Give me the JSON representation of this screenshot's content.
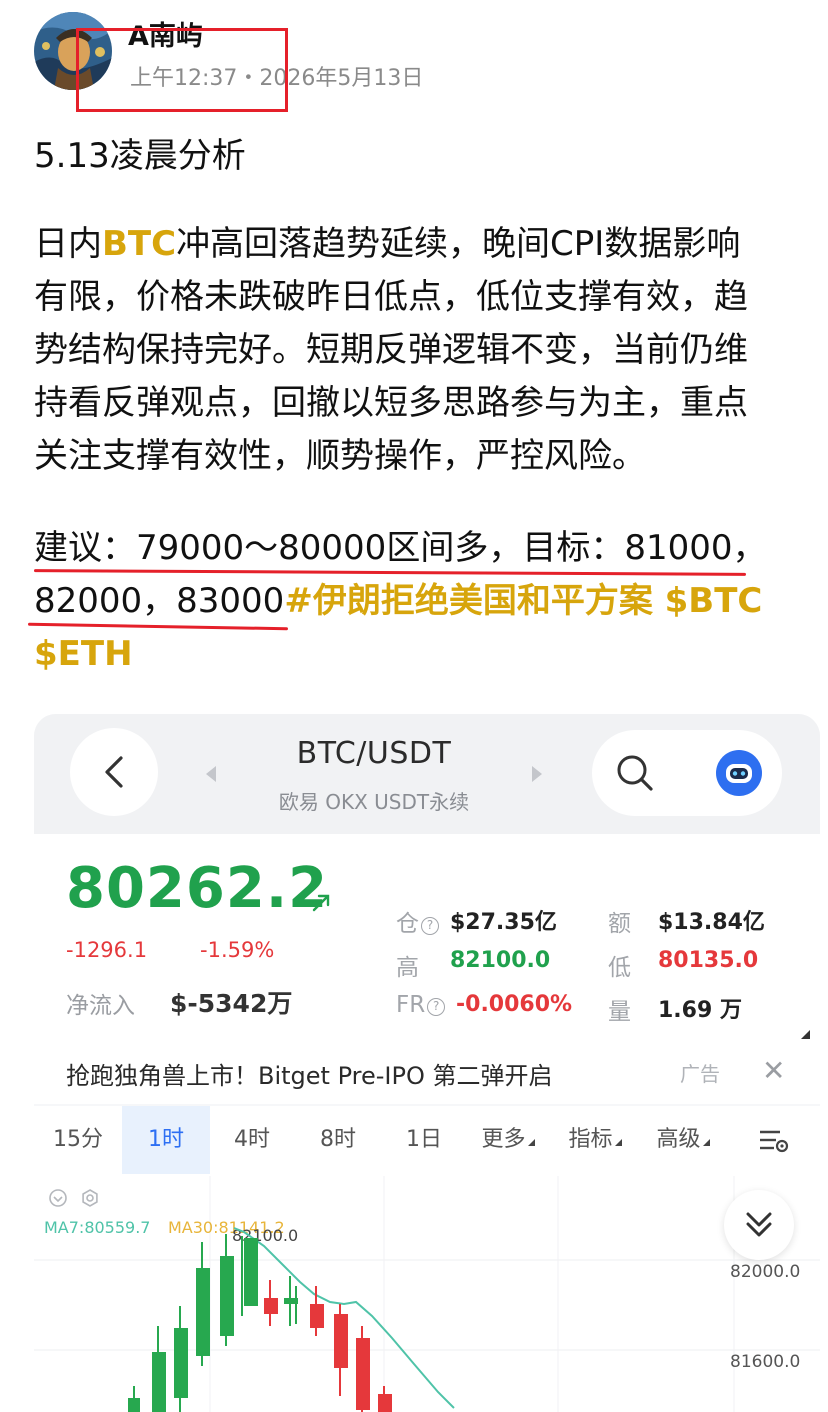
{
  "post": {
    "author": "A南屿",
    "time": "上午12:37・2026年5月13日",
    "subtitle": "5.13凌晨分析",
    "body": {
      "l1_a": "日内",
      "l1_hl": "BTC",
      "l1_b": "冲高回落趋势延续，晚间CPI数据影响",
      "l2": "有限，价格未跌破昨日低点，低位支撑有效，趋",
      "l3": "势结构保持完好。短期反弹逻辑不变，当前仍维",
      "l4": "持看反弹观点，回撤以短多思路参与为主，重点",
      "l5": "关注支撑有效性，顺势操作，严控风险。"
    },
    "suggest": {
      "l1": "建议：79000～80000区间多，目标：81000，",
      "l2_a": "82000，83000",
      "l2_tags": "#伊朗拒绝美国和平方案 $BTC",
      "l3_tags": "$ETH"
    }
  },
  "app": {
    "pair": "BTC/USDT",
    "exchange": "欧易 OKX USDT永续",
    "price": "80262.2",
    "change_abs": "-1296.1",
    "change_pct": "-1.59%",
    "netflow_label": "净流入",
    "netflow_value": "$-5342万",
    "stats": {
      "oi_label": "仓",
      "oi_value": "$27.35亿",
      "vol_amt_label": "额",
      "vol_amt_value": "$13.84亿",
      "high_label": "高",
      "high_value": "82100.0",
      "low_label": "低",
      "low_value": "80135.0",
      "fr_label": "FR",
      "fr_value": "-0.0060%",
      "qty_label": "量",
      "qty_value": "1.69 万"
    },
    "ad_text": "抢跑独角兽上市！Bitget Pre-IPO 第二弹开启",
    "ad_label": "广告",
    "ad_close": "✕",
    "tabs": [
      "15分",
      "1时",
      "4时",
      "8时",
      "1日",
      "更多",
      "指标",
      "高级"
    ],
    "active_tab": "1时",
    "chart": {
      "ma7": "MA7:80559.7",
      "ma30": "MA30:81141.2",
      "high_mark": "82100.0",
      "axis_labels": [
        "82000.0",
        "81600.0"
      ]
    },
    "colors": {
      "up": "#20a14d",
      "down": "#e5383b",
      "accent": "#2d6ff3",
      "hashtag": "#d7a50c",
      "annotation": "#e5202a"
    }
  }
}
